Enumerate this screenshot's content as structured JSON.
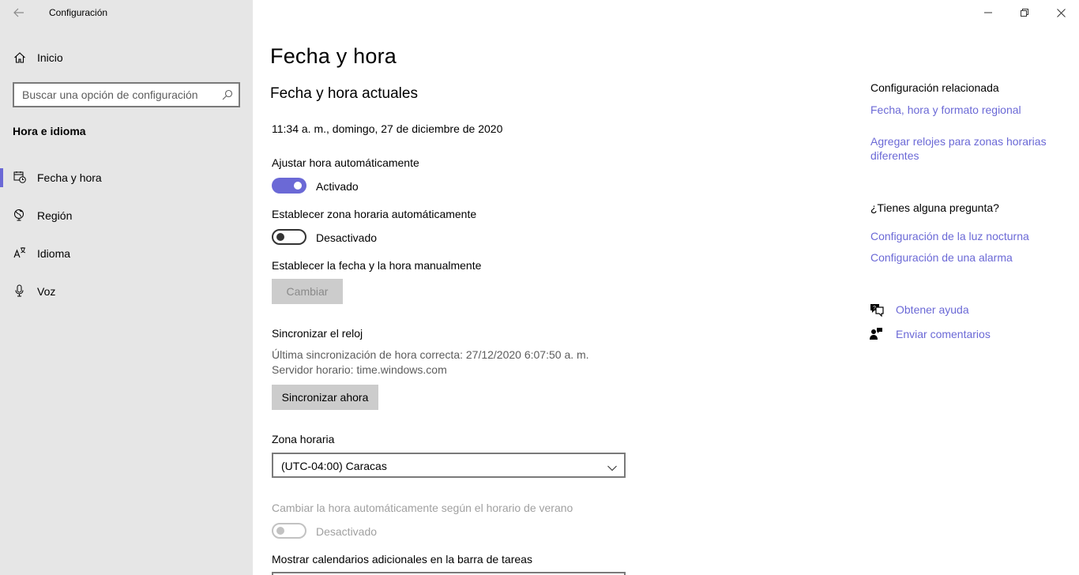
{
  "app": {
    "title": "Configuración"
  },
  "sidebar": {
    "home_label": "Inicio",
    "search_placeholder": "Buscar una opción de configuración",
    "section_title": "Hora e idioma",
    "items": [
      {
        "label": "Fecha y hora",
        "icon": "calendar-clock-icon",
        "selected": true
      },
      {
        "label": "Región",
        "icon": "globe-icon",
        "selected": false
      },
      {
        "label": "Idioma",
        "icon": "language-icon",
        "selected": false
      },
      {
        "label": "Voz",
        "icon": "microphone-icon",
        "selected": false
      }
    ]
  },
  "main": {
    "title": "Fecha y hora",
    "subtitle": "Fecha y hora actuales",
    "current_datetime": "11:34 a. m., domingo, 27 de diciembre de 2020",
    "auto_time": {
      "label": "Ajustar hora automáticamente",
      "state_label": "Activado",
      "on": true
    },
    "auto_timezone": {
      "label": "Establecer zona horaria automáticamente",
      "state_label": "Desactivado",
      "on": false
    },
    "manual": {
      "label": "Establecer la fecha y la hora manualmente",
      "button": "Cambiar"
    },
    "sync": {
      "title": "Sincronizar el reloj",
      "last_sync": "Última sincronización de hora correcta: 27/12/2020 6:07:50 a. m.",
      "server": "Servidor horario: time.windows.com",
      "button": "Sincronizar ahora"
    },
    "timezone": {
      "label": "Zona horaria",
      "value": "(UTC-04:00) Caracas"
    },
    "dst": {
      "label": "Cambiar la hora automáticamente según el horario de verano",
      "state_label": "Desactivado",
      "on": false,
      "disabled": true
    },
    "calendars": {
      "label": "Mostrar calendarios adicionales en la barra de tareas"
    }
  },
  "right": {
    "related_title": "Configuración relacionada",
    "related_links": [
      "Fecha, hora y formato regional",
      "Agregar relojes para zonas horarias diferentes"
    ],
    "question_title": "¿Tienes alguna pregunta?",
    "question_links": [
      "Configuración de la luz nocturna",
      "Configuración de una alarma"
    ],
    "help": [
      {
        "label": "Obtener ayuda",
        "icon": "help-chat-icon"
      },
      {
        "label": "Enviar comentarios",
        "icon": "feedback-icon"
      }
    ]
  },
  "colors": {
    "accent": "#6b69d6",
    "sidebar_bg": "#e6e6e6",
    "button_bg": "#cccccc"
  }
}
